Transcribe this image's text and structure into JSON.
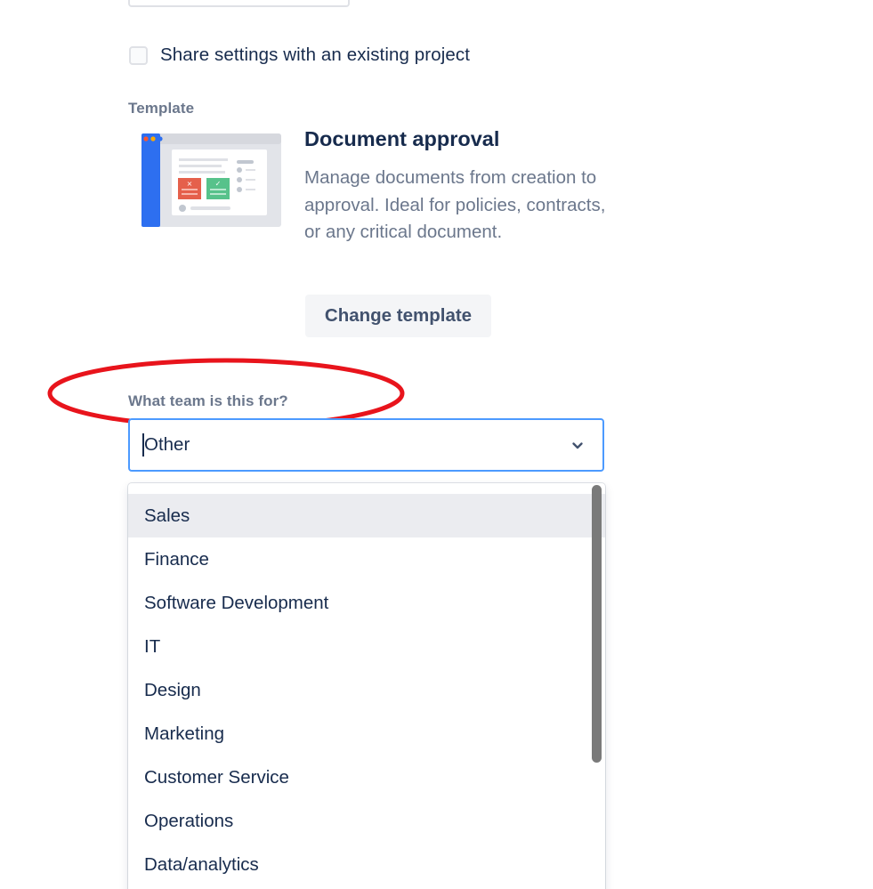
{
  "share": {
    "label": "Share settings with an existing project",
    "checked": false
  },
  "template": {
    "section_label": "Template",
    "name": "Document approval",
    "description": "Manage documents from creation to approval. Ideal for policies, contracts, or any critical document.",
    "change_button": "Change template"
  },
  "team": {
    "label": "What team is this for?",
    "selected": "Other",
    "options": [
      "Sales",
      "Finance",
      "Software Development",
      "IT",
      "Design",
      "Marketing",
      "Customer Service",
      "Operations",
      "Data/analytics"
    ],
    "highlighted_index": 0
  },
  "colors": {
    "accent_focus": "#4c9aff",
    "annotation_red": "#e8141c",
    "text_primary": "#172b4d",
    "text_secondary": "#6b778c"
  },
  "icons": {
    "dropdown": "chevron-down-icon",
    "template_thumbnail": "document-approval-illustration"
  }
}
